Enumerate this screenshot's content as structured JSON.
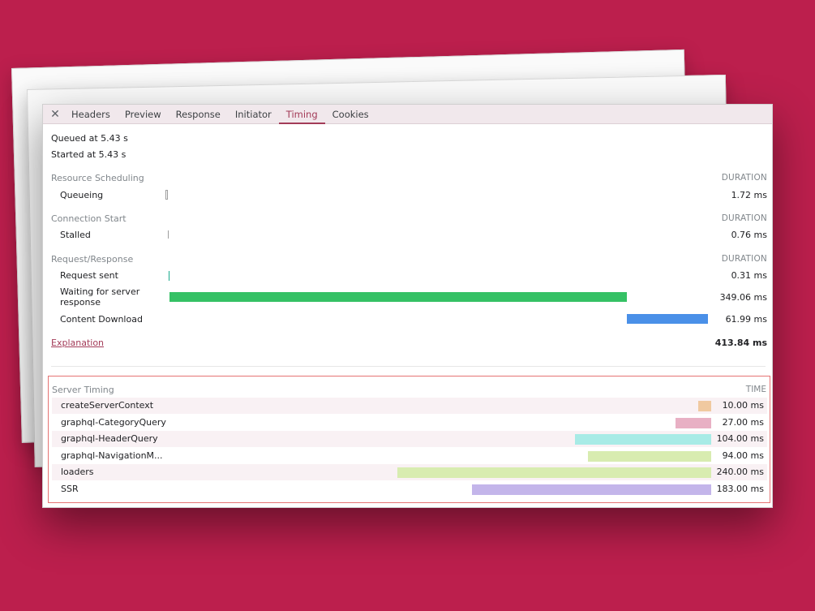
{
  "tabs": [
    {
      "label": "Headers"
    },
    {
      "label": "Preview"
    },
    {
      "label": "Response"
    },
    {
      "label": "Initiator"
    },
    {
      "label": "Timing",
      "active": true
    },
    {
      "label": "Cookies"
    }
  ],
  "meta": {
    "queued": "Queued at 5.43 s",
    "started": "Started at 5.43 s"
  },
  "sections": {
    "scheduling": {
      "title": "Resource Scheduling",
      "duration_header": "DURATION"
    },
    "connection": {
      "title": "Connection Start",
      "duration_header": "DURATION"
    },
    "request": {
      "title": "Request/Response",
      "duration_header": "DURATION"
    }
  },
  "timing_rows": {
    "queueing": {
      "label": "Queueing",
      "value": "1.72 ms"
    },
    "stalled": {
      "label": "Stalled",
      "value": "0.76 ms"
    },
    "request_sent": {
      "label": "Request sent",
      "value": "0.31 ms"
    },
    "waiting": {
      "label": "Waiting for server response",
      "value": "349.06 ms"
    },
    "download": {
      "label": "Content Download",
      "value": "61.99 ms"
    }
  },
  "footer": {
    "explanation": "Explanation",
    "total": "413.84 ms"
  },
  "server_timing": {
    "title": "Server Timing",
    "time_header": "TIME",
    "rows": [
      {
        "label": "createServerContext",
        "value": "10.00 ms",
        "ms": 10,
        "color": "#f0c9a0"
      },
      {
        "label": "graphql-CategoryQuery",
        "value": "27.00 ms",
        "ms": 27,
        "color": "#e8b0c4"
      },
      {
        "label": "graphql-HeaderQuery",
        "value": "104.00 ms",
        "ms": 104,
        "color": "#a8ebe6"
      },
      {
        "label": "graphql-NavigationM...",
        "value": "94.00 ms",
        "ms": 94,
        "color": "#d8ecb0"
      },
      {
        "label": "loaders",
        "value": "240.00 ms",
        "ms": 240,
        "color": "#d8ecb0"
      },
      {
        "label": "SSR",
        "value": "183.00 ms",
        "ms": 183,
        "color": "#c3b5ea"
      }
    ]
  },
  "colors": {
    "background": "#bc1f4d",
    "accent": "#a33b58",
    "waiting_bar": "#35c165",
    "download_bar": "#4a90e8",
    "request_sent_tick": "#19a98c",
    "queueing_tick": "#9e9e9e",
    "server_box_border": "#e57373"
  }
}
